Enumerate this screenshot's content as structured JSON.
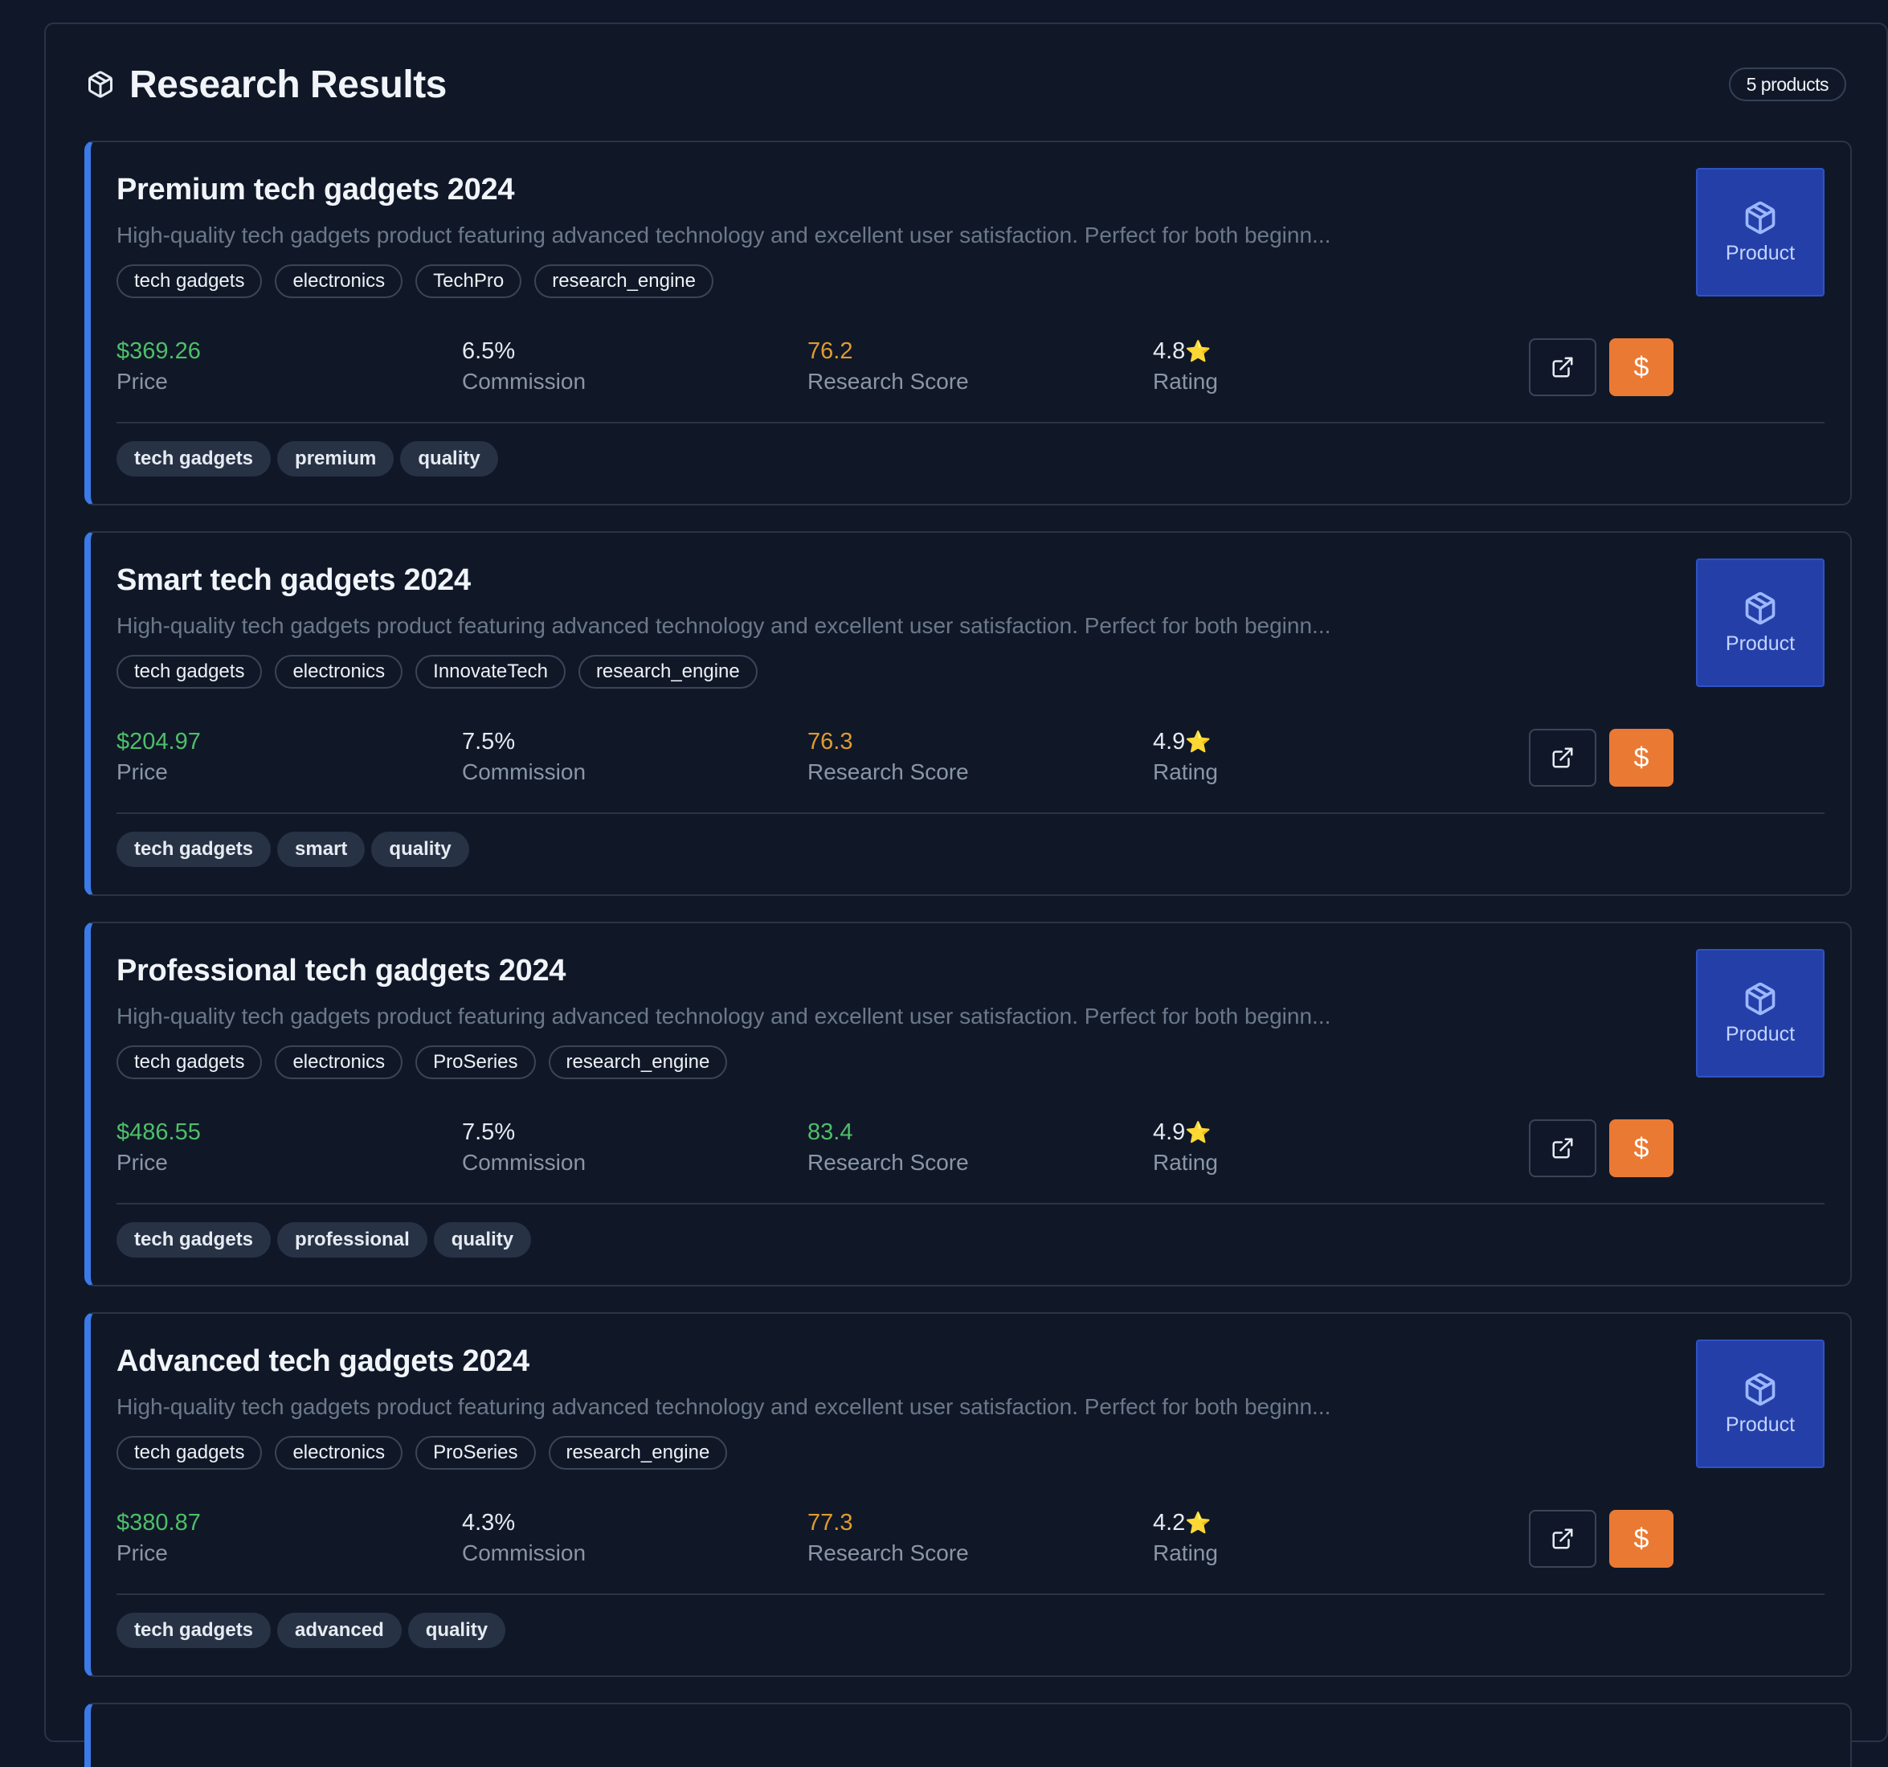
{
  "header": {
    "title": "Research Results",
    "count_label": "5 products"
  },
  "colors": {
    "background": "#0f1729",
    "accent_blue": "#3b7ae8",
    "price_green": "#4ebf68",
    "score_amber": "#e09b2f",
    "buy_orange": "#ea7a33",
    "thumb_blue": "#2440a8"
  },
  "products": [
    {
      "title": "Premium tech gadgets 2024",
      "description": "High-quality tech gadgets product featuring advanced technology and excellent user satisfaction. Perfect for both beginn...",
      "chips": [
        "tech gadgets",
        "electronics",
        "TechPro",
        "research_engine"
      ],
      "price": "$369.26",
      "price_label": "Price",
      "commission": "6.5%",
      "commission_label": "Commission",
      "score": "76.2",
      "score_color": "amber",
      "score_label": "Research Score",
      "rating": "4.8",
      "rating_label": "Rating",
      "tags": [
        "tech gadgets",
        "premium",
        "quality"
      ],
      "thumb_label": "Product"
    },
    {
      "title": "Smart tech gadgets 2024",
      "description": "High-quality tech gadgets product featuring advanced technology and excellent user satisfaction. Perfect for both beginn...",
      "chips": [
        "tech gadgets",
        "electronics",
        "InnovateTech",
        "research_engine"
      ],
      "price": "$204.97",
      "price_label": "Price",
      "commission": "7.5%",
      "commission_label": "Commission",
      "score": "76.3",
      "score_color": "amber",
      "score_label": "Research Score",
      "rating": "4.9",
      "rating_label": "Rating",
      "tags": [
        "tech gadgets",
        "smart",
        "quality"
      ],
      "thumb_label": "Product"
    },
    {
      "title": "Professional tech gadgets 2024",
      "description": "High-quality tech gadgets product featuring advanced technology and excellent user satisfaction. Perfect for both beginn...",
      "chips": [
        "tech gadgets",
        "electronics",
        "ProSeries",
        "research_engine"
      ],
      "price": "$486.55",
      "price_label": "Price",
      "commission": "7.5%",
      "commission_label": "Commission",
      "score": "83.4",
      "score_color": "green",
      "score_label": "Research Score",
      "rating": "4.9",
      "rating_label": "Rating",
      "tags": [
        "tech gadgets",
        "professional",
        "quality"
      ],
      "thumb_label": "Product"
    },
    {
      "title": "Advanced tech gadgets 2024",
      "description": "High-quality tech gadgets product featuring advanced technology and excellent user satisfaction. Perfect for both beginn...",
      "chips": [
        "tech gadgets",
        "electronics",
        "ProSeries",
        "research_engine"
      ],
      "price": "$380.87",
      "price_label": "Price",
      "commission": "4.3%",
      "commission_label": "Commission",
      "score": "77.3",
      "score_color": "amber",
      "score_label": "Research Score",
      "rating": "4.2",
      "rating_label": "Rating",
      "tags": [
        "tech gadgets",
        "advanced",
        "quality"
      ],
      "thumb_label": "Product"
    }
  ],
  "icons": {
    "header": "package-icon",
    "thumb": "package-icon",
    "external": "external-link-icon",
    "buy": "dollar-icon",
    "star": "star-icon",
    "buy_glyph": "$",
    "star_glyph": "⭐"
  }
}
